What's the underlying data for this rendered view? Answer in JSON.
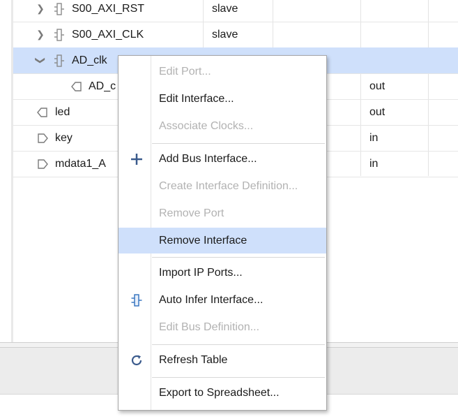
{
  "table": {
    "rows": [
      {
        "name": "S00_AXI_RST",
        "mode": "slave",
        "direction": ""
      },
      {
        "name": "S00_AXI_CLK",
        "mode": "slave",
        "direction": ""
      },
      {
        "name": "AD_clk",
        "mode": "",
        "direction": ""
      },
      {
        "name": "AD_c",
        "mode": "",
        "direction": "out"
      },
      {
        "name": "led",
        "mode": "",
        "direction": "out"
      },
      {
        "name": "key",
        "mode": "",
        "direction": "in"
      },
      {
        "name": "mdata1_A",
        "mode": "",
        "direction": "in"
      }
    ]
  },
  "context_menu": {
    "items": [
      {
        "label": "Edit Port...",
        "enabled": false
      },
      {
        "label": "Edit Interface...",
        "enabled": true
      },
      {
        "label": "Associate Clocks...",
        "enabled": false
      },
      {
        "label": "Add Bus Interface...",
        "enabled": true,
        "icon": "plus-icon"
      },
      {
        "label": "Create Interface Definition...",
        "enabled": false
      },
      {
        "label": "Remove Port",
        "enabled": false
      },
      {
        "label": "Remove Interface",
        "enabled": true,
        "highlighted": true
      },
      {
        "label": "Import IP Ports...",
        "enabled": true
      },
      {
        "label": "Auto Infer Interface...",
        "enabled": true,
        "icon": "interface-icon"
      },
      {
        "label": "Edit Bus Definition...",
        "enabled": false
      },
      {
        "label": "Refresh Table",
        "enabled": true,
        "icon": "refresh-icon"
      },
      {
        "label": "Export to Spreadsheet...",
        "enabled": true
      }
    ]
  },
  "colors": {
    "selection": "#cfe0fb",
    "accent_icon": "#2f6fbd",
    "disabled_text": "#b2b2b2"
  }
}
